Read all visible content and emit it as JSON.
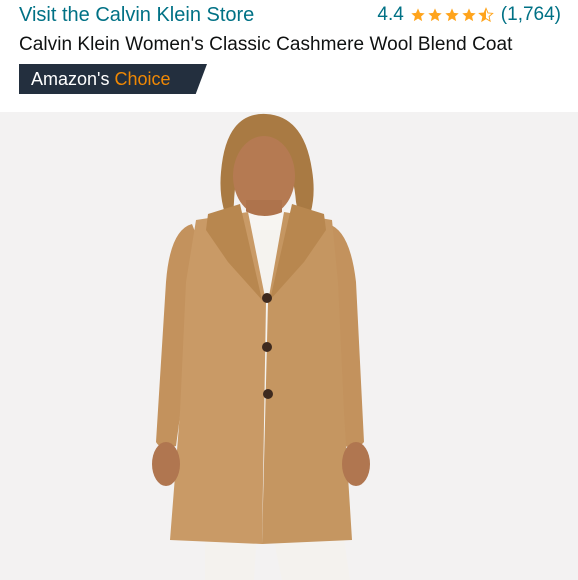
{
  "header": {
    "store_link": "Visit the Calvin Klein Store",
    "rating_value": "4.4",
    "rating_fraction": 0.88,
    "rating_count": "(1,764)",
    "product_title": "Calvin Klein Women's Classic Cashmere Wool Blend Coat",
    "badge_prefix": "Amazon's",
    "badge_suffix": "Choice"
  },
  "photo": {
    "background_color": "#f3f2f2",
    "coat_color": "#c99a66"
  },
  "colors": {
    "link": "#007185",
    "star": "#ffa41c",
    "badge_bg": "#232f3e",
    "badge_accent": "#f08804"
  }
}
